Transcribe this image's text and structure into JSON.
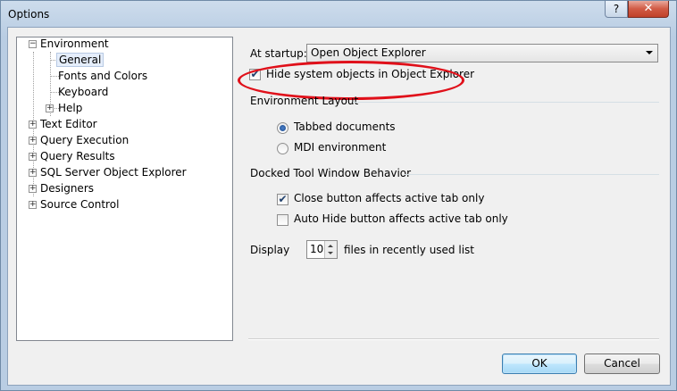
{
  "window": {
    "title": "Options",
    "help_label": "?",
    "close_label": "✕"
  },
  "tree": {
    "nodes": [
      {
        "label": "Environment",
        "expander": "−"
      },
      {
        "label": "General"
      },
      {
        "label": "Fonts and Colors"
      },
      {
        "label": "Keyboard"
      },
      {
        "label": "Help",
        "expander": "+"
      },
      {
        "label": "Text Editor",
        "expander": "+"
      },
      {
        "label": "Query Execution",
        "expander": "+"
      },
      {
        "label": "Query Results",
        "expander": "+"
      },
      {
        "label": "SQL Server Object Explorer",
        "expander": "+"
      },
      {
        "label": "Designers",
        "expander": "+"
      },
      {
        "label": "Source Control",
        "expander": "+"
      }
    ]
  },
  "general": {
    "startup_label": "At startup:",
    "startup_value": "Open Object Explorer",
    "hide_system_label": "Hide system objects in Object Explorer",
    "hide_system_checked": true,
    "layout_heading": "Environment Layout",
    "tabbed_label": "Tabbed documents",
    "tabbed_selected": true,
    "mdi_label": "MDI environment",
    "mdi_selected": false,
    "docked_heading": "Docked Tool Window Behavior",
    "close_btn_label": "Close button affects active tab only",
    "close_btn_checked": true,
    "autohide_label": "Auto Hide button affects active tab only",
    "autohide_checked": false,
    "display_label": "Display",
    "display_value": "10",
    "recent_label": "files in recently used list"
  },
  "buttons": {
    "ok": "OK",
    "cancel": "Cancel"
  },
  "check_glyph": "✔"
}
